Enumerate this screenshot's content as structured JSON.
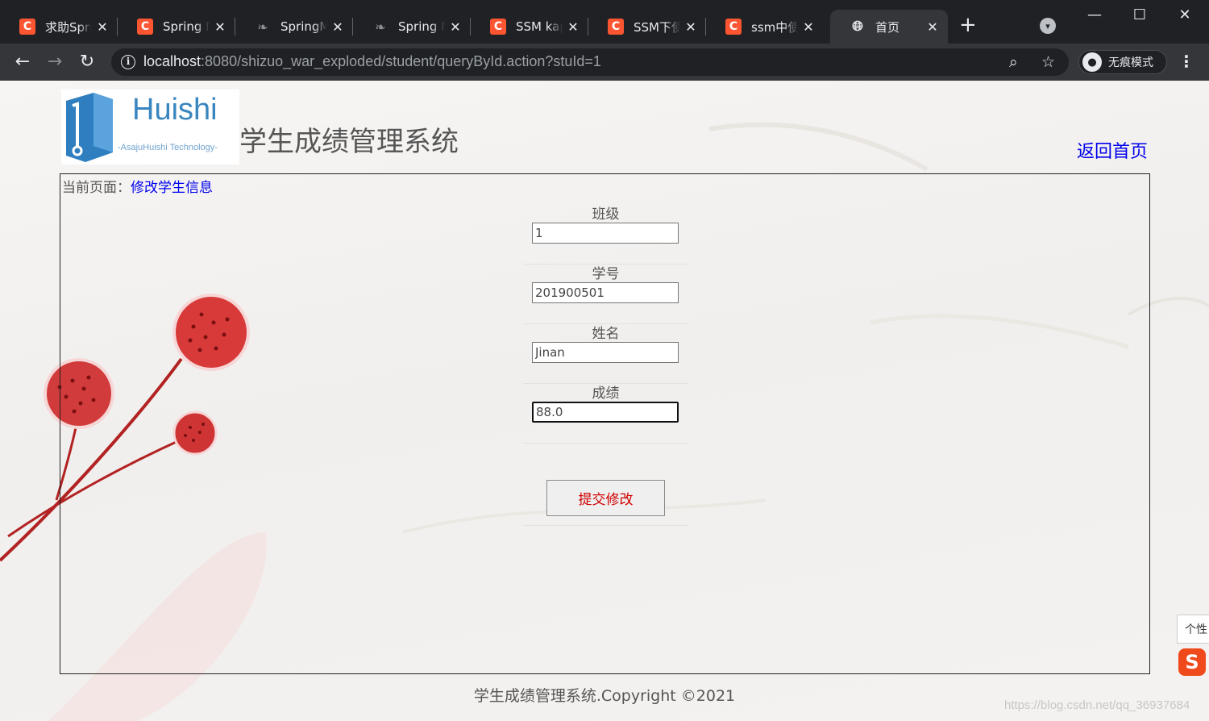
{
  "browser": {
    "tabs": [
      {
        "title": "求助Spring",
        "favicon": "csdn-icon"
      },
      {
        "title": "Spring M",
        "favicon": "csdn-icon"
      },
      {
        "title": "SpringMV",
        "favicon": "spring-icon"
      },
      {
        "title": "Spring M",
        "favicon": "spring-icon"
      },
      {
        "title": "SSM kap",
        "favicon": "csdn-icon"
      },
      {
        "title": "SSM下使",
        "favicon": "csdn-icon"
      },
      {
        "title": "ssm中使用",
        "favicon": "csdn-icon"
      },
      {
        "title": "首页",
        "favicon": "globe-icon",
        "active": true
      }
    ],
    "csdn_glyph": "C",
    "url_host": "localhost",
    "url_rest": ":8080/shizuo_war_exploded/student/queryById.action?stuId=1",
    "incognito_label": "无痕模式",
    "colors": {
      "frame": "#202124",
      "toolbar": "#35363a",
      "csdn": "#fc5531"
    }
  },
  "page": {
    "logo_text": "Huishi",
    "logo_subtext": "-AsajuHuishi Technology-",
    "system_title": "学生成绩管理系统",
    "home_link": "返回首页",
    "breadcrumb_prefix": "当前页面：",
    "breadcrumb_current": "修改学生信息",
    "form": {
      "class_label": "班级",
      "class_value": "1",
      "student_id_label": "学号",
      "student_id_value": "201900501",
      "name_label": "姓名",
      "name_value": "Jinan",
      "score_label": "成绩",
      "score_value": "88.0",
      "submit_label": "提交修改"
    },
    "footer": "学生成绩管理系统.Copyright ©2021",
    "watermark": "https://blog.csdn.net/qq_36937684",
    "ime_tooltip": "个性",
    "ime_glyph": "S",
    "colors": {
      "link": "#0000ee",
      "submit_text": "#d00000",
      "logo_blue": "#3a86bf"
    }
  }
}
